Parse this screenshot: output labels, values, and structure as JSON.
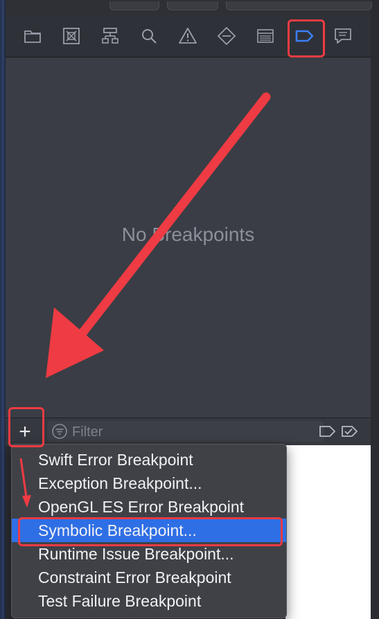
{
  "navigator": {
    "icons": [
      {
        "name": "project-navigator-icon",
        "active": false
      },
      {
        "name": "source-control-icon",
        "active": false
      },
      {
        "name": "symbol-navigator-icon",
        "active": false
      },
      {
        "name": "find-navigator-icon",
        "active": false
      },
      {
        "name": "issue-navigator-icon",
        "active": false
      },
      {
        "name": "test-navigator-icon",
        "active": false
      },
      {
        "name": "debug-navigator-icon",
        "active": false
      },
      {
        "name": "breakpoint-navigator-icon",
        "active": true
      },
      {
        "name": "report-navigator-icon",
        "active": false
      }
    ],
    "active_color": "#3b7ef5",
    "icon_color": "#9a9ea8"
  },
  "content": {
    "empty_message": "No Breakpoints"
  },
  "filter_bar": {
    "add_label": "+",
    "filter_placeholder": "Filter"
  },
  "menu": {
    "items": [
      {
        "label": "Swift Error Breakpoint",
        "selected": false
      },
      {
        "label": "Exception Breakpoint...",
        "selected": false
      },
      {
        "label": "OpenGL ES Error Breakpoint",
        "selected": false
      },
      {
        "label": "Symbolic Breakpoint...",
        "selected": true
      },
      {
        "label": "Runtime Issue Breakpoint...",
        "selected": false
      },
      {
        "label": "Constraint Error Breakpoint",
        "selected": false
      },
      {
        "label": "Test Failure Breakpoint",
        "selected": false
      }
    ]
  },
  "annotations": {
    "highlight_color": "#ef3b43"
  }
}
